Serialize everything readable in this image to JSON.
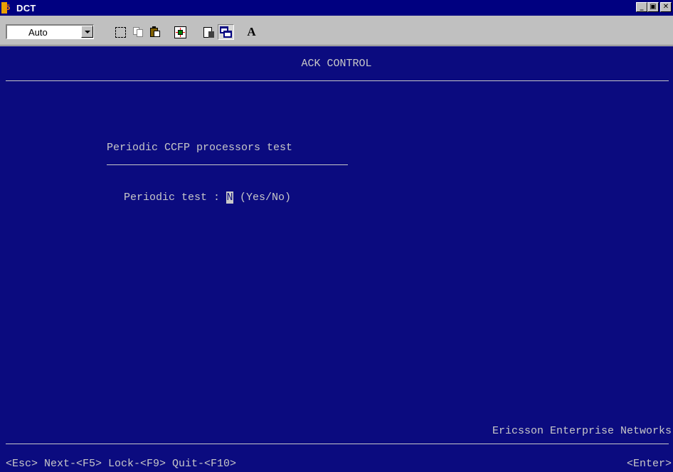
{
  "window": {
    "title": "DCT",
    "buttons": {
      "minimize": "_",
      "maximize": "▣",
      "close": "✕"
    }
  },
  "toolbar": {
    "font_size_value": "Auto",
    "tools": [
      "select-icon",
      "copy-icon",
      "paste-icon",
      "fullscreen-icon",
      "properties-icon",
      "background-icon",
      "font-icon"
    ],
    "font_button_label": "A"
  },
  "screen": {
    "header": "ACK CONTROL",
    "section_title": "Periodic CCFP processors test",
    "field": {
      "label": "Periodic test : ",
      "value": "N",
      "hint": " (Yes/No)"
    },
    "brand": "Ericsson Enterprise Networks",
    "key_hints": "<Esc> Next-<F5> Lock-<F9> Quit-<F10>",
    "enter_hint": "<Enter>"
  },
  "colors": {
    "title_bar": "#000080",
    "screen_bg": "#0b0b7f",
    "screen_fg": "#c8c8c8",
    "chrome": "#c0c0c0"
  }
}
